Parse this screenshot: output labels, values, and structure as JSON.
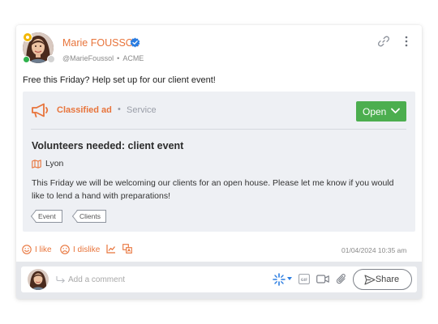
{
  "post": {
    "author": {
      "name": "Marie FOUSSOL",
      "handle": "@MarieFoussol",
      "company": "ACME",
      "separator": "•"
    },
    "text": "Free this Friday? Help set up for our client event!",
    "timestamp": "01/04/2024 10:35 am"
  },
  "ad": {
    "type_label": "Classified ad",
    "separator": "•",
    "category": "Service",
    "status_button": "Open",
    "title": "Volunteers needed: client event",
    "location": "Lyon",
    "body": "This Friday we will be welcoming our clients for an open house. Please let me know if you would like to lend a hand with preparations!",
    "tags": [
      "Event",
      "Clients"
    ]
  },
  "actions": {
    "like": "I like",
    "dislike": "I dislike"
  },
  "comment": {
    "placeholder": "Add a comment",
    "share": "Share"
  },
  "colors": {
    "accent": "#e8743b",
    "open_green": "#4cae4f",
    "verified_blue": "#2b7de1",
    "ad_background": "#eef0f4"
  },
  "icons": [
    "star-badge-icon",
    "verified-icon",
    "link-icon",
    "more-vertical-icon",
    "megaphone-icon",
    "chevron-down-icon",
    "map-icon",
    "smile-icon",
    "frown-icon",
    "chart-icon",
    "translate-icon",
    "reply-arrow-icon",
    "sparkle-icon",
    "gif-icon",
    "video-icon",
    "paperclip-icon",
    "send-icon"
  ]
}
